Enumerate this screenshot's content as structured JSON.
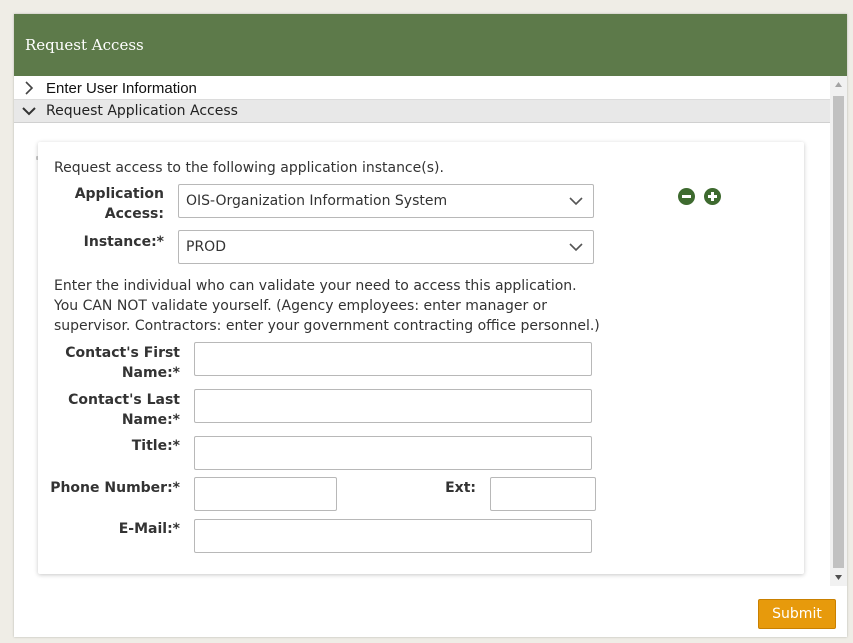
{
  "window": {
    "title": "Request Access"
  },
  "accordion": {
    "sections": [
      {
        "label": "Enter User Information",
        "expanded": false
      },
      {
        "label": "Request Application Access",
        "expanded": true
      }
    ]
  },
  "form": {
    "intro": "Request access to the following application instance(s).",
    "application_access": {
      "label_line1": "Application",
      "label_line2": "Access:",
      "value": "OIS-Organization Information System"
    },
    "instance": {
      "label": "Instance:*",
      "value": "PROD"
    },
    "info_lines": [
      "Enter the individual who can validate your need to access this application.",
      "You CAN NOT validate yourself. (Agency employees: enter manager or",
      "supervisor. Contractors: enter your government contracting office personnel.)"
    ],
    "first_name": {
      "label_line1": "Contact's First",
      "label_line2": "Name:*",
      "value": ""
    },
    "last_name": {
      "label_line1": "Contact's Last",
      "label_line2": "Name:*",
      "value": ""
    },
    "title": {
      "label": "Title:*",
      "value": ""
    },
    "phone": {
      "label": "Phone Number:*",
      "value": ""
    },
    "ext": {
      "label": "Ext:",
      "value": ""
    },
    "email": {
      "label": "E-Mail:*",
      "value": ""
    },
    "remove_icon": "minus-circle-icon",
    "add_icon": "plus-circle-icon"
  },
  "actions": {
    "submit_label": "Submit"
  },
  "colors": {
    "titlebar": "#5d7a4a",
    "icon_buttons": "#3e6a2f",
    "submit": "#e79a0c"
  }
}
